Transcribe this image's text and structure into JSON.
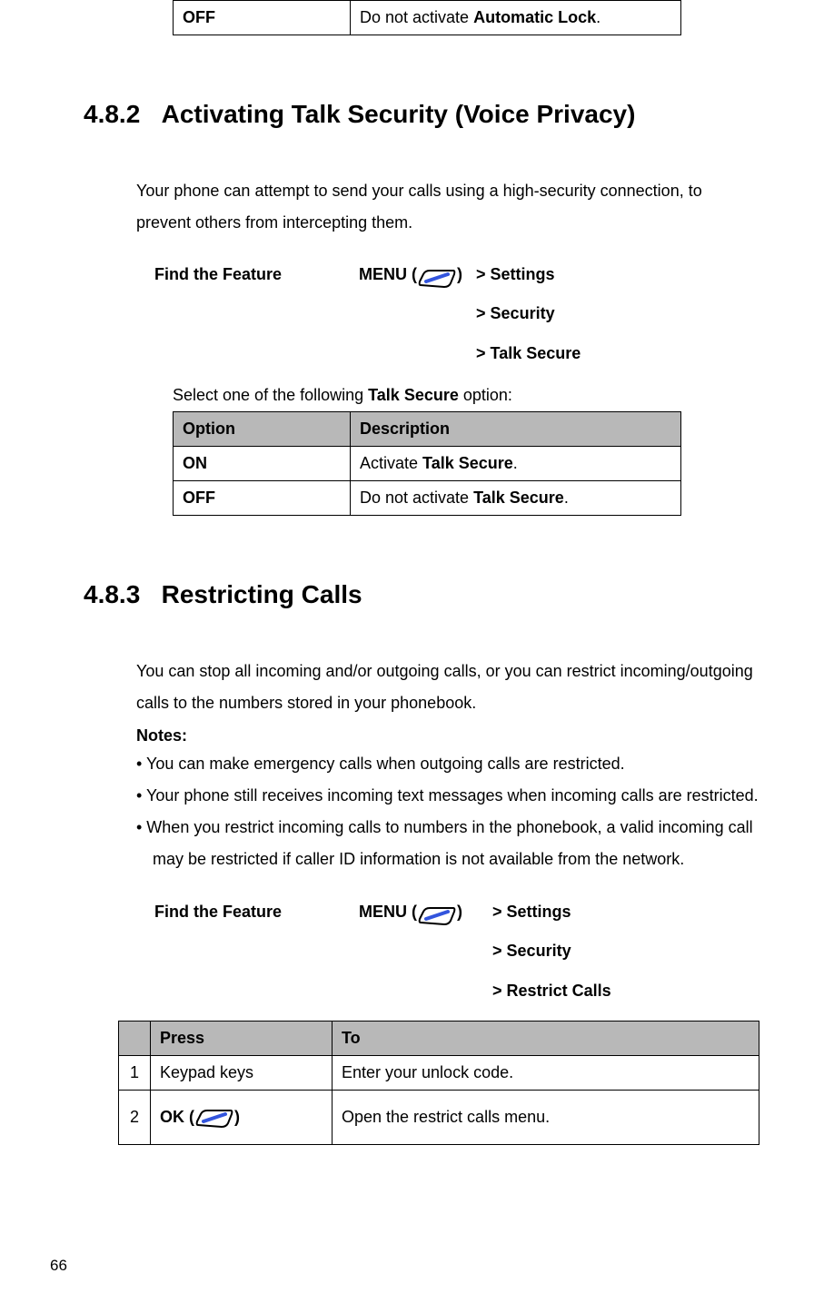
{
  "topTable": {
    "col1": "OFF",
    "col2_pre": "Do not activate ",
    "col2_bold": "Automatic Lock",
    "col2_post": "."
  },
  "section482": {
    "num": "4.8.2",
    "title": "Activating Talk Security (Voice Privacy)",
    "body": "Your phone can attempt to send your calls using a high-security connection, to prevent others from intercepting them.",
    "findFeature": {
      "label": "Find the Feature",
      "menu_pre": "MENU (",
      "menu_post": ")",
      "path": [
        "> Settings",
        "> Security",
        "> Talk Secure"
      ]
    },
    "selectLine_pre": "Select one of the following ",
    "selectLine_bold": "Talk Secure",
    "selectLine_post": " option:",
    "table": {
      "headers": [
        "Option",
        "Description"
      ],
      "rows": [
        {
          "opt": "ON",
          "desc_pre": "Activate ",
          "desc_bold": "Talk Secure",
          "desc_post": "."
        },
        {
          "opt": "OFF",
          "desc_pre": "Do not activate ",
          "desc_bold": "Talk Secure",
          "desc_post": "."
        }
      ]
    }
  },
  "section483": {
    "num": "4.8.3",
    "title": "Restricting Calls",
    "body": "You can stop all incoming and/or outgoing calls, or you can restrict incoming/outgoing calls to the numbers stored in your phonebook.",
    "notesLabel": "Notes:",
    "notes": [
      "• You can make emergency calls when outgoing calls are restricted.",
      "• Your phone still receives incoming text messages when incoming calls are restricted.",
      "• When you restrict incoming calls to numbers in the phonebook, a valid incoming call may be restricted if caller ID information is not available from the network."
    ],
    "findFeature": {
      "label": "Find the Feature",
      "menu_pre": "MENU (",
      "menu_post": ")",
      "path": [
        "> Settings",
        "> Security",
        "> Restrict Calls"
      ]
    },
    "table": {
      "headers": [
        "",
        "Press",
        "To"
      ],
      "rows": [
        {
          "num": "1",
          "press": "Keypad keys",
          "to": "Enter your unlock code."
        },
        {
          "num": "2",
          "press_pre": "OK (",
          "press_post": ")",
          "to": "Open the restrict calls menu."
        }
      ]
    }
  },
  "pageNumber": "66"
}
